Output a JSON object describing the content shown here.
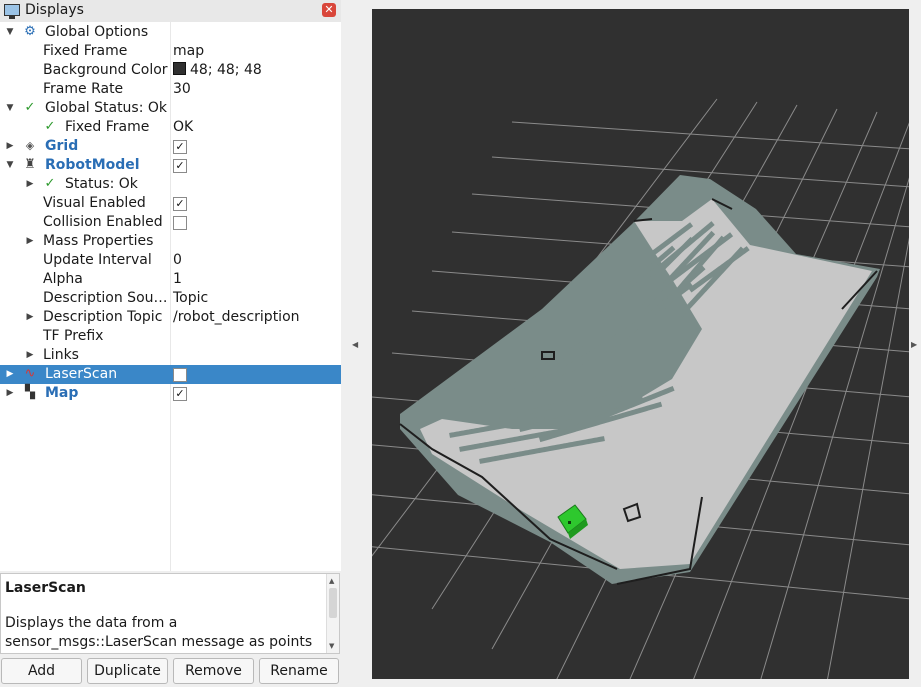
{
  "panel": {
    "title": "Displays",
    "close_icon": "close-icon",
    "description_title": "LaserScan",
    "description_text": "Displays the data from a sensor_msgs::LaserScan message as points in the world, drawn as points, billboards, or"
  },
  "tree": {
    "global_options": "Global Options",
    "fixed_frame_label": "Fixed Frame",
    "fixed_frame_value": "map",
    "background_color_label": "Background Color",
    "background_color_value": "48; 48; 48",
    "background_color_hex": "#303030",
    "frame_rate_label": "Frame Rate",
    "frame_rate_value": "30",
    "global_status": "Global Status: Ok",
    "status_fixed_frame_label": "Fixed Frame",
    "status_fixed_frame_value": "OK",
    "grid": "Grid",
    "robot_model": "RobotModel",
    "status_ok": "Status: Ok",
    "visual_enabled": "Visual Enabled",
    "collision_enabled": "Collision Enabled",
    "mass_properties": "Mass Properties",
    "update_interval_label": "Update Interval",
    "update_interval_value": "0",
    "alpha_label": "Alpha",
    "alpha_value": "1",
    "description_source_label": "Description Sou…",
    "description_source_value": "Topic",
    "description_topic_label": "Description Topic",
    "description_topic_value": "/robot_description",
    "tf_prefix": "TF Prefix",
    "links": "Links",
    "laser_scan": "LaserScan",
    "map": "Map",
    "checks": {
      "grid": true,
      "robot_model": true,
      "visual_enabled": true,
      "collision_enabled": false,
      "laser_scan": false,
      "map": true
    }
  },
  "buttons": {
    "add": "Add",
    "duplicate": "Duplicate",
    "remove": "Remove",
    "rename": "Rename"
  },
  "colors": {
    "selection": "#3a87c8",
    "link_blue": "#2a6eb5",
    "viewport_bg": "#303030",
    "map_free": "#c5c5c5",
    "map_unknown": "#7a8c89",
    "robot": "#2ec82e"
  }
}
